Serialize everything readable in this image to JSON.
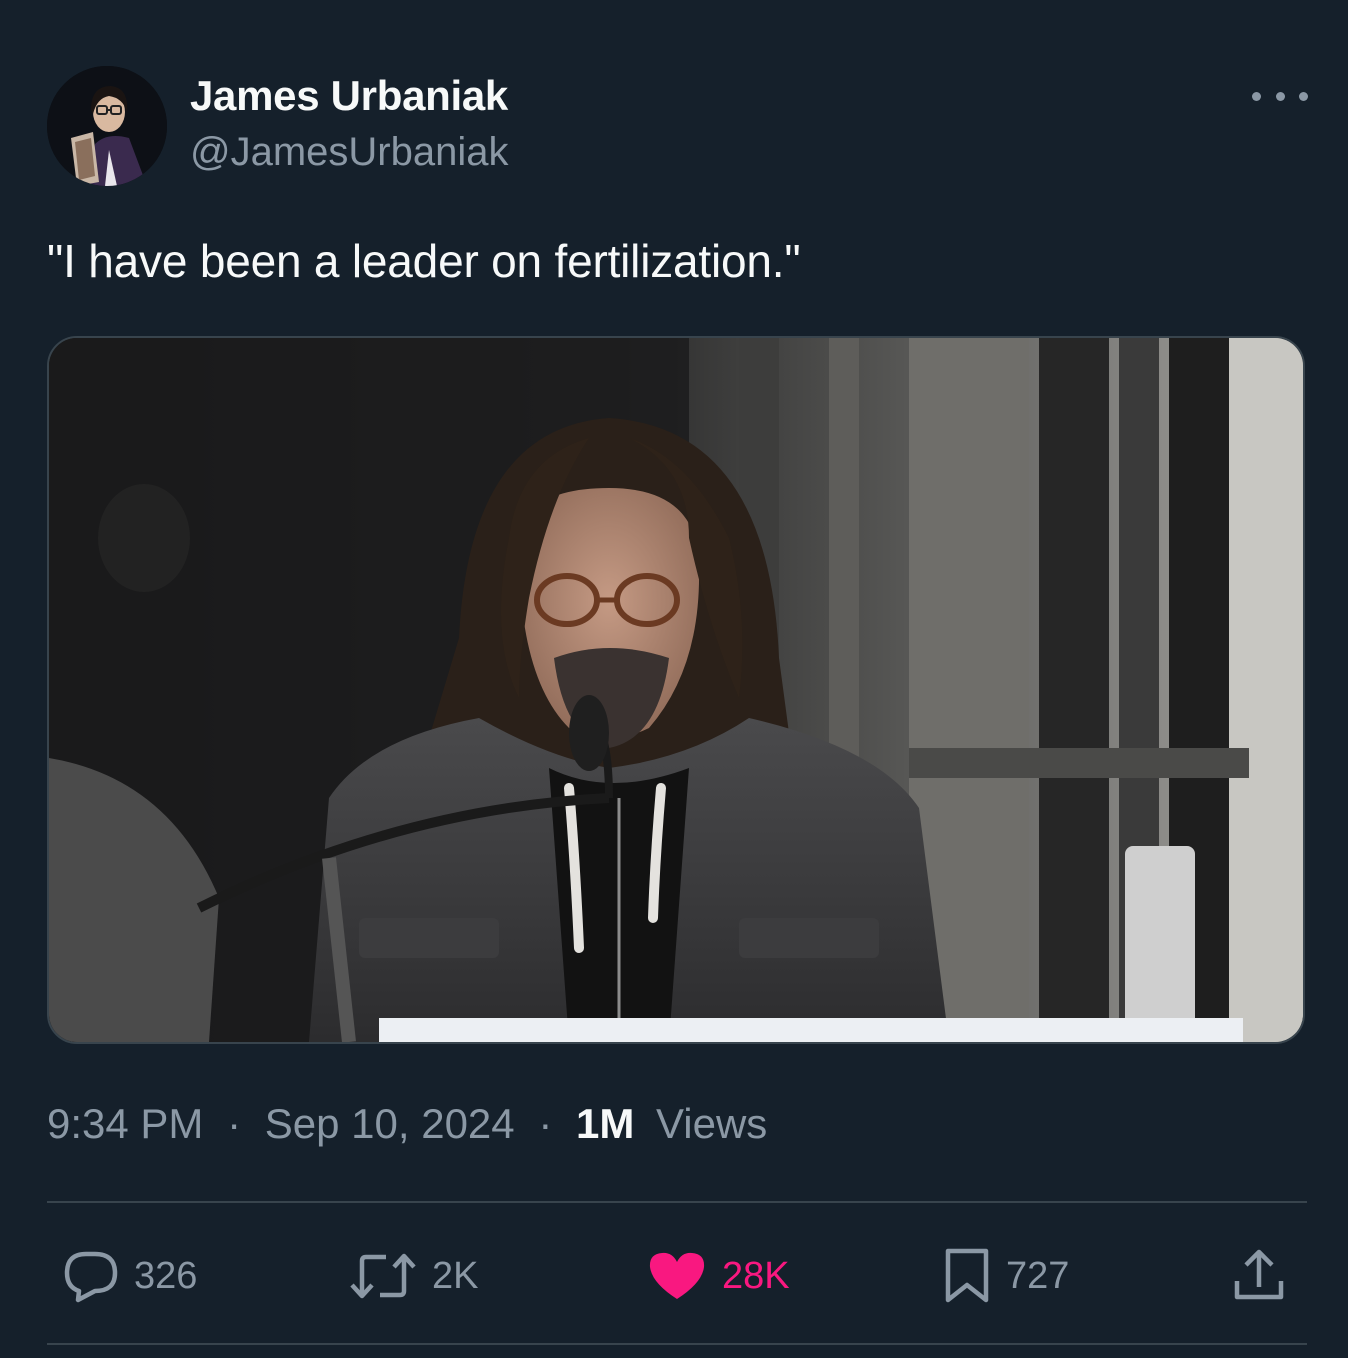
{
  "author": {
    "display_name": "James Urbaniak",
    "handle": "@JamesUrbaniak"
  },
  "tweet": {
    "text": "\"I have been a leader on fertilization.\"",
    "media": {
      "kind": "photo",
      "alt": "Man with long hair and glasses speaking at a podium microphone"
    },
    "time": "9:34 PM",
    "separator": "·",
    "date": "Sep 10, 2024",
    "views_count": "1M",
    "views_label": "Views"
  },
  "actions": {
    "replies": "326",
    "retweets": "2K",
    "likes": "28K",
    "bookmarks": "727"
  },
  "icons": {
    "more": "more-horizontal-icon",
    "reply": "speech-bubble-icon",
    "retweet": "retweet-arrows-icon",
    "like": "heart-icon",
    "bookmark": "bookmark-icon",
    "share": "share-upload-icon"
  },
  "colors": {
    "background": "#15202b",
    "text_primary": "#f7f9f9",
    "text_secondary": "#8b98a5",
    "divider": "#38444d",
    "like_active": "#f91880"
  }
}
